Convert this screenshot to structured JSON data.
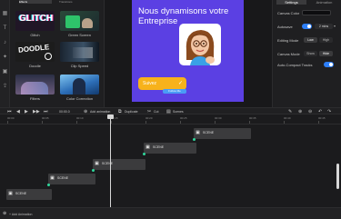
{
  "media_panel": {
    "tabs": [
      "Effects",
      "Transitions"
    ],
    "items": [
      {
        "label": "Glitch",
        "thumb_text": "GLITCH"
      },
      {
        "label": "Green Screen",
        "thumb_text": ""
      },
      {
        "label": "Doodle",
        "thumb_text": "DOODLE"
      },
      {
        "label": "Clip Speed",
        "thumb_text": ""
      },
      {
        "label": "Filters",
        "thumb_text": ""
      },
      {
        "label": "Color Correction",
        "thumb_text": ""
      }
    ]
  },
  "preview": {
    "title": "Nous dynamisons votre Entreprise",
    "badge_text": "Suivez",
    "follow_text": "Follow Me"
  },
  "settings": {
    "tabs": [
      "Settings",
      "Animation"
    ],
    "canvas_color_label": "Canvas Color",
    "autosave_label": "Autosave",
    "autosave_interval": "2 mins",
    "editing_mode_label": "Editing Mode",
    "editing_mode_options": [
      "Low",
      "High"
    ],
    "canvas_mode_label": "Canvas Mode",
    "canvas_mode_options": [
      "Show",
      "Hide"
    ],
    "auto_compact_label": "Auto-Compact Tracks"
  },
  "toolbar": {
    "time": "00:00.0",
    "add_animation": "Add animation",
    "duplicate": "Duplicate",
    "cut": "Cut",
    "scenes": "Scenes"
  },
  "timeline": {
    "ruler": [
      "00:00",
      "00:05",
      "00:10",
      "00:15",
      "00:20",
      "00:25",
      "00:30",
      "00:35",
      "00:40",
      "00:45"
    ],
    "clips": [
      "SCENE",
      "SCENE",
      "SCENE",
      "SCENE",
      "SCENE"
    ],
    "bottom_label": "+ Add Animation"
  },
  "colors": {
    "canvas_bg": "#5b40e3",
    "badge": "#f7b21b",
    "accent_blue": "#2d7ff9",
    "keyframe": "#2fd69a"
  }
}
